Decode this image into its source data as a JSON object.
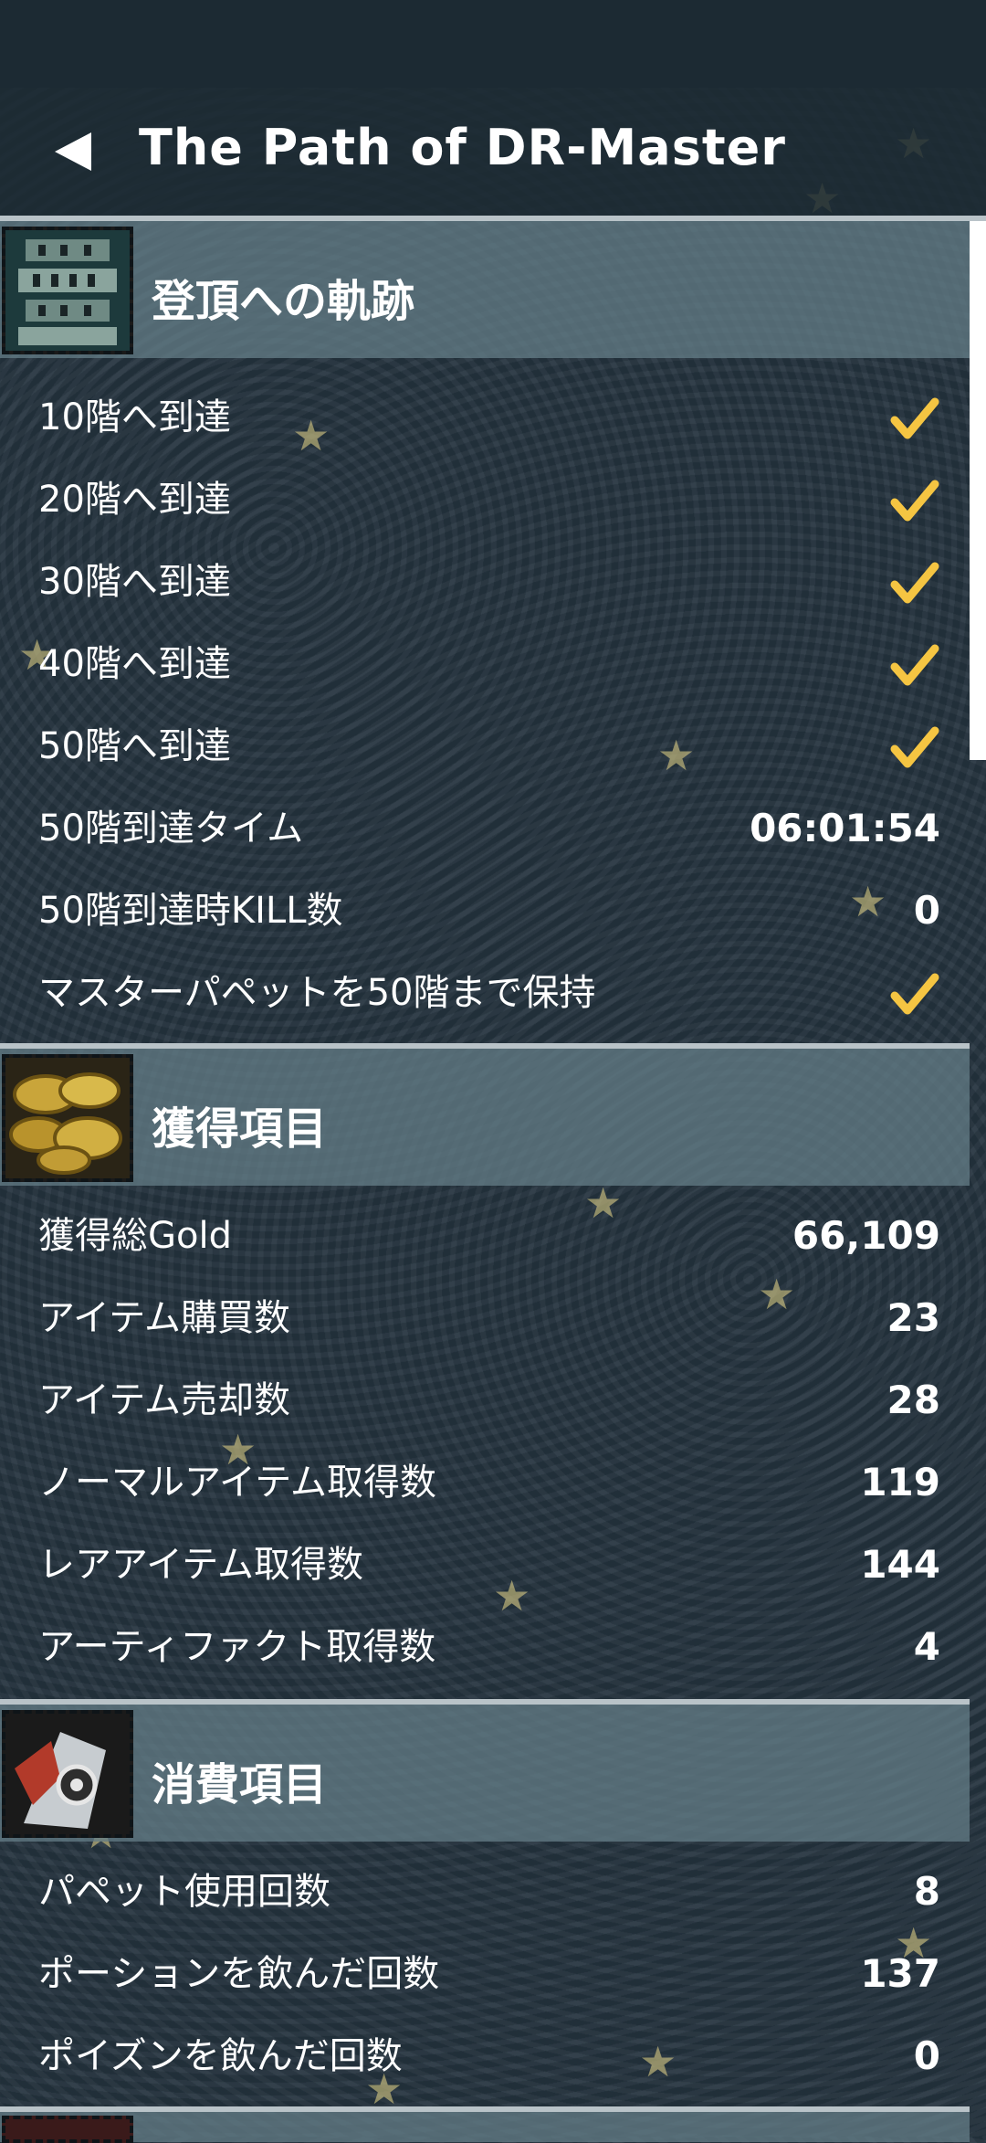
{
  "header": {
    "title": "The Path of DR-Master",
    "back_icon": "back-arrow-icon"
  },
  "colors": {
    "background": "#25343f",
    "section_header": "#647d87",
    "check": "#f5c542",
    "text": "#ffffff"
  },
  "sections": [
    {
      "title": "登頂への軌跡",
      "icon": "tower-icon",
      "rows": [
        {
          "label": "10階へ到達",
          "check": true
        },
        {
          "label": "20階へ到達",
          "check": true
        },
        {
          "label": "30階へ到達",
          "check": true
        },
        {
          "label": "40階へ到達",
          "check": true
        },
        {
          "label": "50階へ到達",
          "check": true
        },
        {
          "label": "50階到達タイム",
          "value": "06:01:54"
        },
        {
          "label": "50階到達時KILL数",
          "value": "0"
        },
        {
          "label": "マスターパペットを50階まで保持",
          "check": true
        }
      ]
    },
    {
      "title": "獲得項目",
      "icon": "gold-coins-icon",
      "rows": [
        {
          "label": "獲得総Gold",
          "value": "66,109"
        },
        {
          "label": "アイテム購買数",
          "value": "23"
        },
        {
          "label": "アイテム売却数",
          "value": "28"
        },
        {
          "label": "ノーマルアイテム取得数",
          "value": "119"
        },
        {
          "label": "レアアイテム取得数",
          "value": "144"
        },
        {
          "label": "アーティファクト取得数",
          "value": "4"
        }
      ]
    },
    {
      "title": "消費項目",
      "icon": "puppet-icon",
      "rows": [
        {
          "label": "パペット使用回数",
          "value": "8"
        },
        {
          "label": "ポーションを飲んだ回数",
          "value": "137"
        },
        {
          "label": "ポイズンを飲んだ回数",
          "value": "0"
        }
      ]
    }
  ]
}
